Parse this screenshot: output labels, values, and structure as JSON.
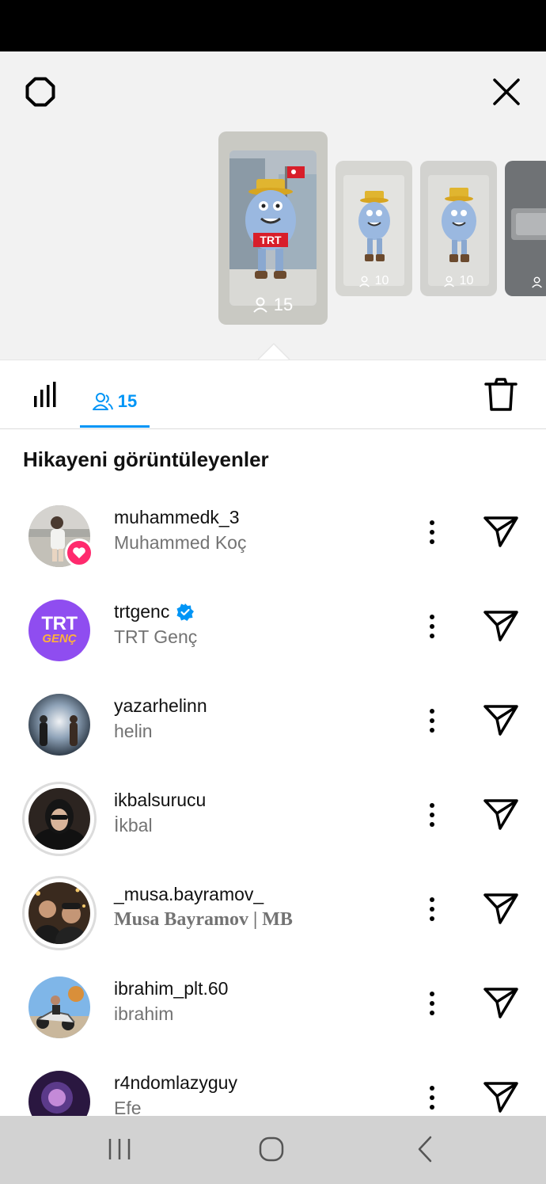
{
  "header": {
    "settings_icon": "gear-icon",
    "close_icon": "close-icon"
  },
  "stories": [
    {
      "viewers": "15",
      "selected": true
    },
    {
      "viewers": "10",
      "selected": false
    },
    {
      "viewers": "10",
      "selected": false
    },
    {
      "viewers": "",
      "selected": false
    }
  ],
  "tabs": {
    "stats_icon": "bar-chart-icon",
    "viewers_count": "15",
    "delete_icon": "trash-icon"
  },
  "section_title": "Hikayeni görüntüleyenler",
  "viewers": [
    {
      "username": "muhammedk_3",
      "name": "Muhammed Koç",
      "liked": true,
      "verified": false,
      "ring": false
    },
    {
      "username": "trtgenc",
      "name": "TRT Genç",
      "liked": false,
      "verified": true,
      "ring": false,
      "avatar_text_top": "TRT",
      "avatar_text_bottom": "GENÇ"
    },
    {
      "username": "yazarhelinn",
      "name": "helin",
      "liked": false,
      "verified": false,
      "ring": false
    },
    {
      "username": "ikbalsurucu",
      "name": "İkbal",
      "liked": false,
      "verified": false,
      "ring": true
    },
    {
      "username": "_musa.bayramov_",
      "name": "Musa Bayramov | MB",
      "liked": false,
      "verified": false,
      "ring": true
    },
    {
      "username": "ibrahim_plt.60",
      "name": "ibrahim",
      "liked": false,
      "verified": false,
      "ring": false
    },
    {
      "username": "r4ndomlazyguy",
      "name": "Efe",
      "liked": false,
      "verified": false,
      "ring": false
    }
  ],
  "colors": {
    "accent": "#0095f6",
    "like": "#ff2a6d",
    "trt_purple": "#8f4df0"
  }
}
